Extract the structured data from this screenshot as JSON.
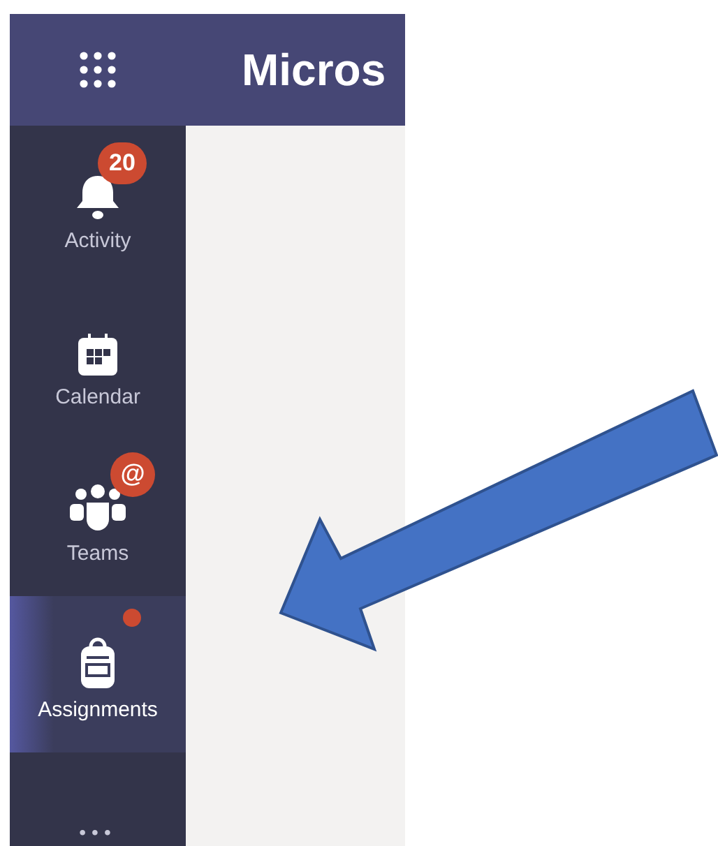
{
  "header": {
    "title": "Micros"
  },
  "nav": [
    {
      "label": "Activity",
      "kind": "bell",
      "selected": false,
      "badge": {
        "kind": "count",
        "text": "20"
      }
    },
    {
      "label": "Calendar",
      "kind": "calendar",
      "selected": false
    },
    {
      "label": "Teams",
      "kind": "people",
      "selected": false,
      "badge": {
        "kind": "mention",
        "text": "@"
      }
    },
    {
      "label": "Assignments",
      "kind": "backpack",
      "selected": true,
      "badge": {
        "kind": "dot"
      }
    }
  ],
  "more": {
    "text": "•••"
  }
}
